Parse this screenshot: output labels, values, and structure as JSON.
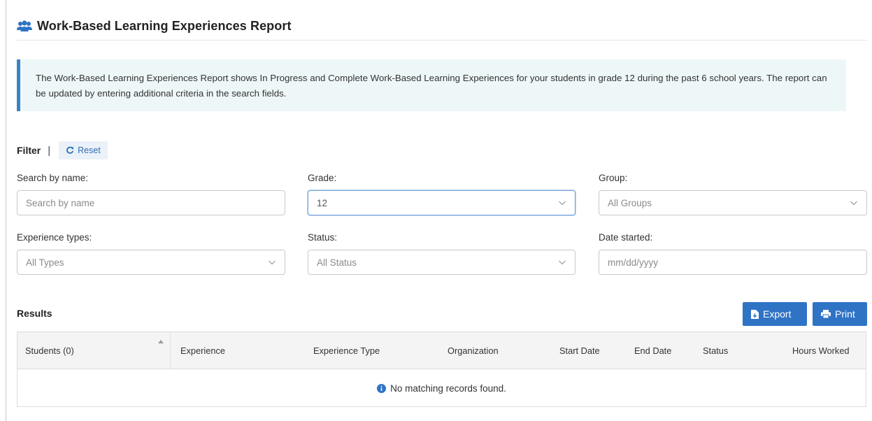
{
  "header": {
    "title": "Work-Based Learning Experiences Report",
    "icon": "users-icon"
  },
  "info": {
    "text": "The Work-Based Learning Experiences Report shows In Progress and Complete Work-Based Learning Experiences for your students in grade 12 during the past 6 school years. The report can be updated by entering additional criteria in the search fields."
  },
  "filter": {
    "label": "Filter",
    "separator": "|",
    "reset_label": "Reset",
    "search_name": {
      "label": "Search by name:",
      "placeholder": "Search by name"
    },
    "grade": {
      "label": "Grade:",
      "value": "12"
    },
    "group": {
      "label": "Group:",
      "value": "All Groups"
    },
    "experience_types": {
      "label": "Experience types:",
      "value": "All Types"
    },
    "status": {
      "label": "Status:",
      "value": "All Status"
    },
    "date_started": {
      "label": "Date started:",
      "placeholder": "mm/dd/yyyy"
    }
  },
  "results": {
    "label": "Results",
    "export_label": "Export",
    "print_label": "Print",
    "columns": [
      "Students (0)",
      "Experience",
      "Experience Type",
      "Organization",
      "Start Date",
      "End Date",
      "Status",
      "Hours Worked"
    ],
    "empty_message": "No matching records found."
  },
  "colors": {
    "accent": "#2f73c5",
    "info_bg": "#eef7f8",
    "info_border": "#3a84c4"
  }
}
